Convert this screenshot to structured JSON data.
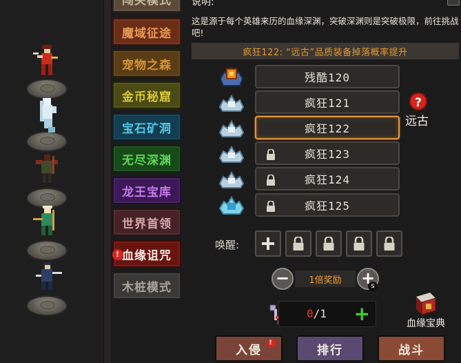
{
  "heroes": [
    {
      "name": "hero-red-swordswoman"
    },
    {
      "name": "hero-white-spirit"
    },
    {
      "name": "hero-dark-warrior"
    },
    {
      "name": "hero-green-archer"
    },
    {
      "name": "hero-blue-swordsman"
    }
  ],
  "modes": [
    {
      "label": "闯关模式",
      "bg": "#5a4a3a",
      "fg": "#c8b89c",
      "border": "#2a221a"
    },
    {
      "label": "魔域征途",
      "bg": "#6b2d18",
      "fg": "#e79a54",
      "border": "#3a1609"
    },
    {
      "label": "宠物之森",
      "bg": "#5a3d14",
      "fg": "#d59436",
      "border": "#2e1f0a"
    },
    {
      "label": "金币秘窟",
      "bg": "#4a4a12",
      "fg": "#d7c63a",
      "border": "#26260a"
    },
    {
      "label": "宝石矿洞",
      "bg": "#123e52",
      "fg": "#56c7e4",
      "border": "#0a2230"
    },
    {
      "label": "无尽深渊",
      "bg": "#164a18",
      "fg": "#5ed456",
      "border": "#0b260c"
    },
    {
      "label": "龙王宝库",
      "bg": "#3c1858",
      "fg": "#c77be6",
      "border": "#210b33"
    },
    {
      "label": "世界首领",
      "bg": "#462226",
      "fg": "#d4a7aa",
      "border": "#261214"
    },
    {
      "label": "血缘诅咒",
      "bg": "#6a1410",
      "fg": "#f4e6e0",
      "border": "#3a0806",
      "alert": "!"
    },
    {
      "label": "木桩模式",
      "bg": "#3a3836",
      "fg": "#a9a39b",
      "border": "#1e1d1c"
    }
  ],
  "panel": {
    "desc_title": "说明:",
    "desc_text": "这是源于每个英雄来历的血缘深渊，突破深渊则是突破极限，前往挑战吧!",
    "banner": "疯狂122: “远古”品质装备掉落概率提升",
    "levels": [
      {
        "label": "残酷120",
        "crest": "red",
        "locked": false,
        "selected": false
      },
      {
        "label": "疯狂121",
        "crest": "white",
        "locked": false,
        "selected": false
      },
      {
        "label": "疯狂122",
        "crest": "white",
        "locked": false,
        "selected": true
      },
      {
        "label": "疯狂123",
        "crest": "white",
        "locked": true,
        "selected": false
      },
      {
        "label": "疯狂124",
        "crest": "white",
        "locked": true,
        "selected": false
      },
      {
        "label": "疯狂125",
        "crest": "cyan",
        "locked": true,
        "selected": false
      }
    ],
    "unknown_icon": "?",
    "unknown_label": "远古",
    "awaken_label": "唤醒:",
    "awaken_slots": [
      "add",
      "locked",
      "locked",
      "locked",
      "locked"
    ],
    "reward": {
      "minus": "−",
      "label": "1倍奖励",
      "plus": "+",
      "badge": "s"
    },
    "ticket": {
      "current": "0",
      "max": "/1",
      "plus": "+"
    },
    "codex_label": "血缘宝典",
    "actions": [
      {
        "label": "入侵",
        "bg": "#7a4438",
        "alert": "!"
      },
      {
        "label": "排行",
        "bg": "#5a4a72"
      },
      {
        "label": "战斗",
        "bg": "#8a4a34"
      }
    ],
    "colors": {
      "banner_text": "#e39a2c",
      "selected_border": "#e0913a",
      "ticket_current": "#e53a2e",
      "ticket_plus": "#3fcf2c"
    }
  }
}
